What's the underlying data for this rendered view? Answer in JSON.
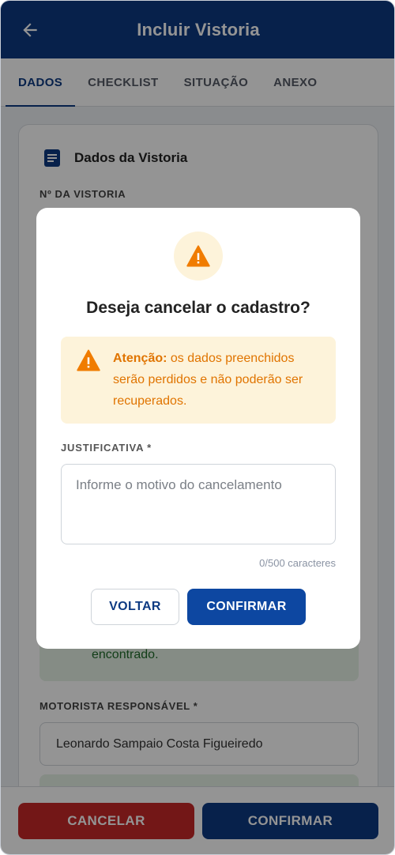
{
  "header": {
    "title": "Incluir Vistoria",
    "back_icon": "arrow-left-icon"
  },
  "tabs": [
    {
      "label": "DADOS",
      "active": true
    },
    {
      "label": "CHECKLIST",
      "active": false
    },
    {
      "label": "SITUAÇÃO",
      "active": false
    },
    {
      "label": "ANEXO",
      "active": false
    }
  ],
  "card": {
    "title": "Dados da Vistoria",
    "icon": "document-icon",
    "vistoria_label": "Nº DA VISTORIA",
    "success_text": "encontrado.",
    "motorista_label": "MOTORISTA RESPONSÁVEL *",
    "motorista_value": "Leonardo Sampaio Costa Figueiredo"
  },
  "bottom": {
    "cancel_label": "CANCELAR",
    "confirm_label": "CONFIRMAR"
  },
  "modal": {
    "title": "Deseja cancelar o cadastro?",
    "alert_strong": "Atenção:",
    "alert_text": " os dados preenchidos serão perdidos e não poderão ser recuperados.",
    "justificativa_label": "JUSTIFICATIVA *",
    "justificativa_placeholder": "Informe o motivo do cancelamento",
    "counter": "0/500 caracteres",
    "back_label": "VOLTAR",
    "confirm_label": "CONFIRMAR"
  },
  "colors": {
    "primary": "#0d3a82",
    "danger": "#c62828",
    "warning": "#f07c00",
    "warning_bg": "#fdf3da"
  }
}
